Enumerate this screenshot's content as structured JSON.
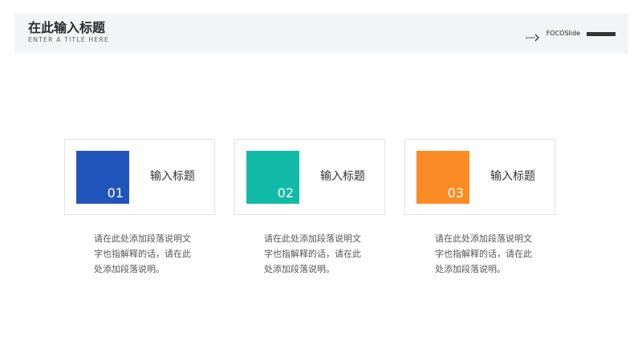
{
  "header": {
    "title": "在此输入标题",
    "subtitle": "ENTER A TITLE HERE",
    "brand": "FOCOSlide",
    "arrow_icon": "dotted-arrow-icon"
  },
  "colors": {
    "blue": "#2255bb",
    "teal": "#12bba8",
    "orange": "#fb8c25"
  },
  "cards": [
    {
      "number": "01",
      "label": "输入标题",
      "description": "请在此处添加段落说明文字也指解释的话，请在此处添加段落说明。"
    },
    {
      "number": "02",
      "label": "输入标题",
      "description": "请在此处添加段落说明文字也指解释的话，请在此处添加段落说明。"
    },
    {
      "number": "03",
      "label": "输入标题",
      "description": "请在此处添加段落说明文字也指解释的话，请在此处添加段落说明。"
    }
  ]
}
